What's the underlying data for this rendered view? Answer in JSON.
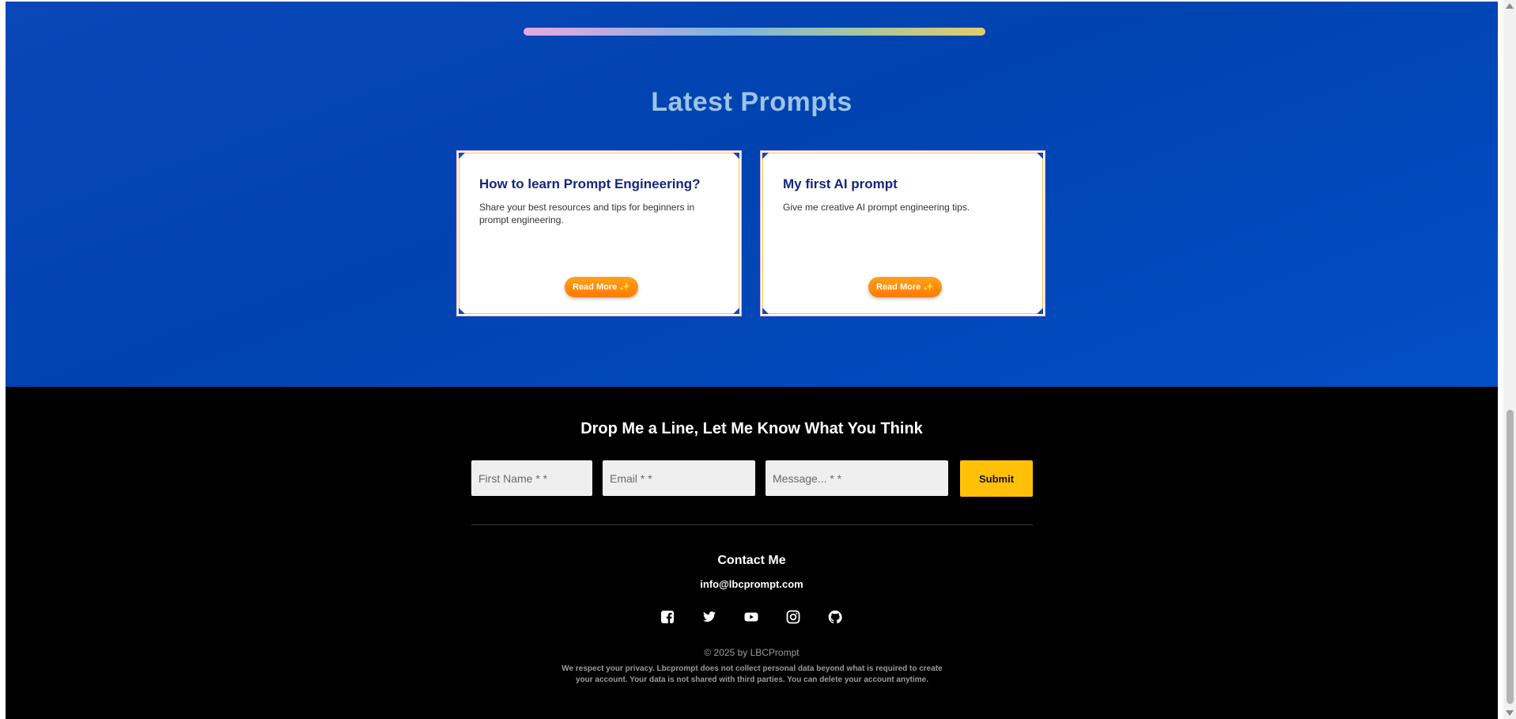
{
  "prompts": {
    "title": "Latest Prompts",
    "cards": [
      {
        "title": "How to learn Prompt Engineering?",
        "body": "Share your best resources and tips for beginners in prompt engineering.",
        "button_label": "Read More ✨"
      },
      {
        "title": "My first AI prompt",
        "body": "Give me creative AI prompt engineering tips.",
        "button_label": "Read More ✨"
      }
    ]
  },
  "footer": {
    "title": "Drop Me a Line, Let Me Know What You Think",
    "form": {
      "first_name_placeholder": "First Name * *",
      "email_placeholder": "Email * *",
      "message_placeholder": "Message... * *",
      "submit_label": "Submit"
    },
    "contact": {
      "title": "Contact Me",
      "email": "info@lbcprompt.com"
    },
    "social_icons": [
      "facebook-icon",
      "twitter-icon",
      "youtube-icon",
      "instagram-icon",
      "github-icon"
    ],
    "copyright": "© 2025 by LBCPrompt",
    "privacy": "We respect your privacy. Lbcprompt does not collect personal data beyond what is required to create your account. Your data is not shared with third parties. You can delete your account anytime."
  },
  "colors": {
    "hero_background": "#0043b0",
    "section_title": "#9ec3e9",
    "card_title": "#14277d",
    "read_more_button": "#ff8c00",
    "footer_background": "#000000",
    "submit_button": "#ffc107"
  }
}
